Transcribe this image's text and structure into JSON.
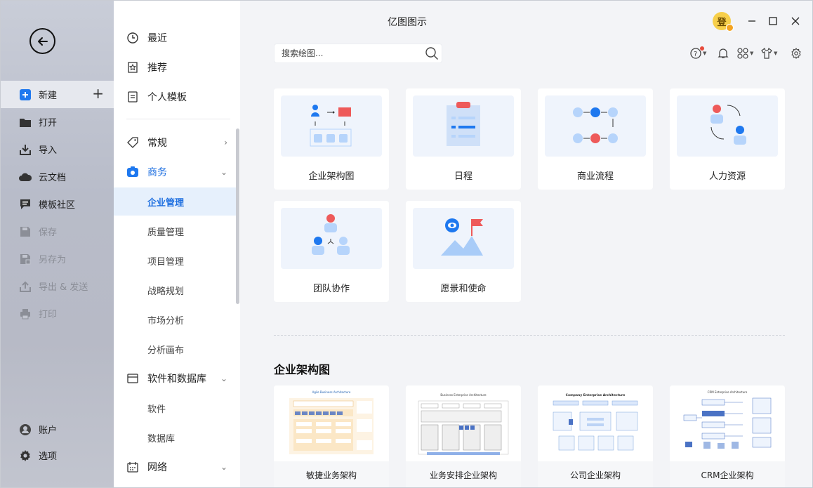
{
  "window": {
    "title": "亿图图示"
  },
  "nav": {
    "items": [
      {
        "label": "新建",
        "icon": "new-plus-icon"
      },
      {
        "label": "打开",
        "icon": "folder-icon"
      },
      {
        "label": "导入",
        "icon": "import-icon"
      },
      {
        "label": "云文档",
        "icon": "cloud-icon"
      },
      {
        "label": "模板社区",
        "icon": "community-icon"
      },
      {
        "label": "保存",
        "icon": "save-icon"
      },
      {
        "label": "另存为",
        "icon": "save-as-icon"
      },
      {
        "label": "导出 & 发送",
        "icon": "export-icon"
      },
      {
        "label": "打印",
        "icon": "print-icon"
      }
    ],
    "bottom": [
      {
        "label": "账户",
        "icon": "account-icon"
      },
      {
        "label": "选项",
        "icon": "settings-icon"
      }
    ]
  },
  "categories": {
    "top": [
      {
        "label": "最近"
      },
      {
        "label": "推荐"
      },
      {
        "label": "个人模板"
      }
    ],
    "groups": [
      {
        "label": "常规"
      },
      {
        "label": "商务",
        "subs": [
          "企业管理",
          "质量管理",
          "项目管理",
          "战略规划",
          "市场分析",
          "分析画布"
        ]
      },
      {
        "label": "软件和数据库",
        "subs": [
          "软件",
          "数据库"
        ]
      },
      {
        "label": "网络"
      }
    ]
  },
  "search": {
    "placeholder": "搜索绘图..."
  },
  "cards": [
    {
      "label": "企业架构图"
    },
    {
      "label": "日程"
    },
    {
      "label": "商业流程"
    },
    {
      "label": "人力资源"
    },
    {
      "label": "团队协作"
    },
    {
      "label": "愿景和使命"
    }
  ],
  "section": {
    "title": "企业架构图"
  },
  "templates": [
    {
      "label": "敏捷业务架构",
      "thumb_title": "Agile Business Architecture"
    },
    {
      "label": "业务安排企业架构",
      "thumb_title": "Business Enterprise Architecture"
    },
    {
      "label": "公司企业架构",
      "thumb_title": "Company Enterprise Architecture"
    },
    {
      "label": "CRM企业架构",
      "thumb_title": "CRM Enterprise Architecture"
    }
  ],
  "avatar": {
    "text": "登"
  },
  "colors": {
    "accent": "#1e6fe0",
    "red": "#ee5a5a",
    "lightblue": "#b6d4fb"
  }
}
